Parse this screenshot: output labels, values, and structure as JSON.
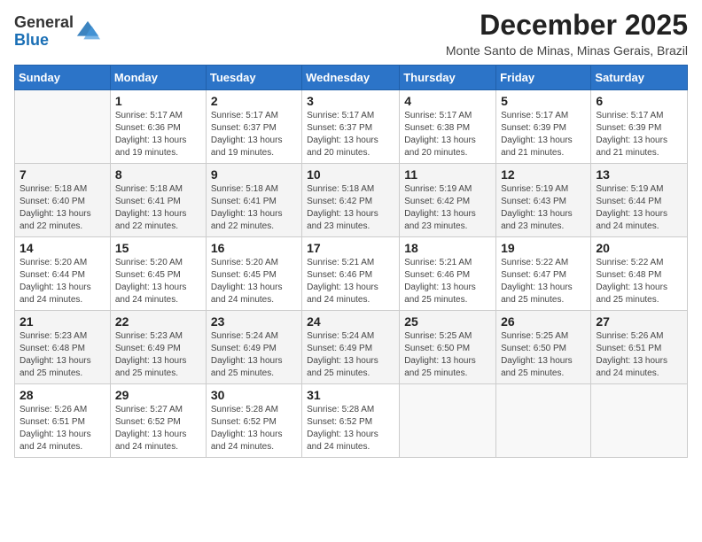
{
  "logo": {
    "general": "General",
    "blue": "Blue"
  },
  "header": {
    "month_year": "December 2025",
    "location": "Monte Santo de Minas, Minas Gerais, Brazil"
  },
  "calendar": {
    "days_of_week": [
      "Sunday",
      "Monday",
      "Tuesday",
      "Wednesday",
      "Thursday",
      "Friday",
      "Saturday"
    ],
    "weeks": [
      [
        {
          "day": "",
          "info": ""
        },
        {
          "day": "1",
          "info": "Sunrise: 5:17 AM\nSunset: 6:36 PM\nDaylight: 13 hours\nand 19 minutes."
        },
        {
          "day": "2",
          "info": "Sunrise: 5:17 AM\nSunset: 6:37 PM\nDaylight: 13 hours\nand 19 minutes."
        },
        {
          "day": "3",
          "info": "Sunrise: 5:17 AM\nSunset: 6:37 PM\nDaylight: 13 hours\nand 20 minutes."
        },
        {
          "day": "4",
          "info": "Sunrise: 5:17 AM\nSunset: 6:38 PM\nDaylight: 13 hours\nand 20 minutes."
        },
        {
          "day": "5",
          "info": "Sunrise: 5:17 AM\nSunset: 6:39 PM\nDaylight: 13 hours\nand 21 minutes."
        },
        {
          "day": "6",
          "info": "Sunrise: 5:17 AM\nSunset: 6:39 PM\nDaylight: 13 hours\nand 21 minutes."
        }
      ],
      [
        {
          "day": "7",
          "info": "Sunrise: 5:18 AM\nSunset: 6:40 PM\nDaylight: 13 hours\nand 22 minutes."
        },
        {
          "day": "8",
          "info": "Sunrise: 5:18 AM\nSunset: 6:41 PM\nDaylight: 13 hours\nand 22 minutes."
        },
        {
          "day": "9",
          "info": "Sunrise: 5:18 AM\nSunset: 6:41 PM\nDaylight: 13 hours\nand 22 minutes."
        },
        {
          "day": "10",
          "info": "Sunrise: 5:18 AM\nSunset: 6:42 PM\nDaylight: 13 hours\nand 23 minutes."
        },
        {
          "day": "11",
          "info": "Sunrise: 5:19 AM\nSunset: 6:42 PM\nDaylight: 13 hours\nand 23 minutes."
        },
        {
          "day": "12",
          "info": "Sunrise: 5:19 AM\nSunset: 6:43 PM\nDaylight: 13 hours\nand 23 minutes."
        },
        {
          "day": "13",
          "info": "Sunrise: 5:19 AM\nSunset: 6:44 PM\nDaylight: 13 hours\nand 24 minutes."
        }
      ],
      [
        {
          "day": "14",
          "info": "Sunrise: 5:20 AM\nSunset: 6:44 PM\nDaylight: 13 hours\nand 24 minutes."
        },
        {
          "day": "15",
          "info": "Sunrise: 5:20 AM\nSunset: 6:45 PM\nDaylight: 13 hours\nand 24 minutes."
        },
        {
          "day": "16",
          "info": "Sunrise: 5:20 AM\nSunset: 6:45 PM\nDaylight: 13 hours\nand 24 minutes."
        },
        {
          "day": "17",
          "info": "Sunrise: 5:21 AM\nSunset: 6:46 PM\nDaylight: 13 hours\nand 24 minutes."
        },
        {
          "day": "18",
          "info": "Sunrise: 5:21 AM\nSunset: 6:46 PM\nDaylight: 13 hours\nand 25 minutes."
        },
        {
          "day": "19",
          "info": "Sunrise: 5:22 AM\nSunset: 6:47 PM\nDaylight: 13 hours\nand 25 minutes."
        },
        {
          "day": "20",
          "info": "Sunrise: 5:22 AM\nSunset: 6:48 PM\nDaylight: 13 hours\nand 25 minutes."
        }
      ],
      [
        {
          "day": "21",
          "info": "Sunrise: 5:23 AM\nSunset: 6:48 PM\nDaylight: 13 hours\nand 25 minutes."
        },
        {
          "day": "22",
          "info": "Sunrise: 5:23 AM\nSunset: 6:49 PM\nDaylight: 13 hours\nand 25 minutes."
        },
        {
          "day": "23",
          "info": "Sunrise: 5:24 AM\nSunset: 6:49 PM\nDaylight: 13 hours\nand 25 minutes."
        },
        {
          "day": "24",
          "info": "Sunrise: 5:24 AM\nSunset: 6:49 PM\nDaylight: 13 hours\nand 25 minutes."
        },
        {
          "day": "25",
          "info": "Sunrise: 5:25 AM\nSunset: 6:50 PM\nDaylight: 13 hours\nand 25 minutes."
        },
        {
          "day": "26",
          "info": "Sunrise: 5:25 AM\nSunset: 6:50 PM\nDaylight: 13 hours\nand 25 minutes."
        },
        {
          "day": "27",
          "info": "Sunrise: 5:26 AM\nSunset: 6:51 PM\nDaylight: 13 hours\nand 24 minutes."
        }
      ],
      [
        {
          "day": "28",
          "info": "Sunrise: 5:26 AM\nSunset: 6:51 PM\nDaylight: 13 hours\nand 24 minutes."
        },
        {
          "day": "29",
          "info": "Sunrise: 5:27 AM\nSunset: 6:52 PM\nDaylight: 13 hours\nand 24 minutes."
        },
        {
          "day": "30",
          "info": "Sunrise: 5:28 AM\nSunset: 6:52 PM\nDaylight: 13 hours\nand 24 minutes."
        },
        {
          "day": "31",
          "info": "Sunrise: 5:28 AM\nSunset: 6:52 PM\nDaylight: 13 hours\nand 24 minutes."
        },
        {
          "day": "",
          "info": ""
        },
        {
          "day": "",
          "info": ""
        },
        {
          "day": "",
          "info": ""
        }
      ]
    ]
  }
}
